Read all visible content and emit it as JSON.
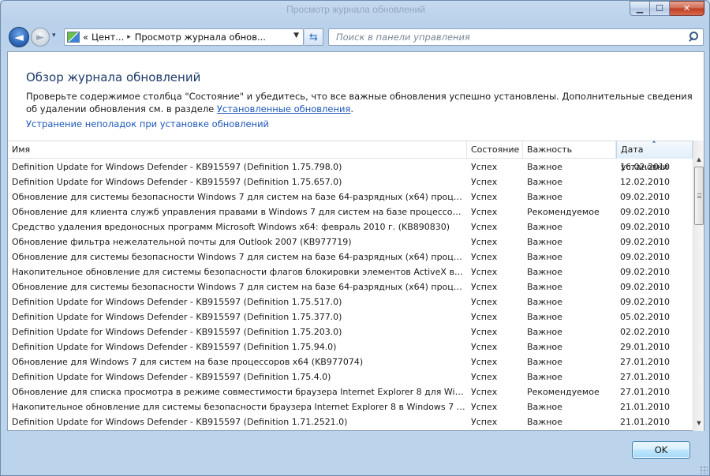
{
  "window": {
    "title": "Просмотр журнала обновлений",
    "caption": {
      "minimize": "▁",
      "maximize": "☐",
      "close": "✕"
    }
  },
  "nav": {
    "back_glyph": "◄",
    "forward_glyph": "►",
    "history_glyph": "▾",
    "address_prefix": "«",
    "address_segments": [
      "Цент...",
      "Просмотр журнала обнов..."
    ],
    "address_sep": "▸",
    "address_drop": "▼",
    "refresh_glyph": "⇆",
    "search_placeholder": "Поиск в панели управления"
  },
  "page": {
    "heading": "Обзор журнала обновлений",
    "description_text": "Проверьте содержимое столбца \"Состояние\" и убедитесь, что все важные обновления успешно установлены. Дополнительные сведения об удалении обновления см. в разделе ",
    "description_link": "Установленные обновления",
    "description_end": ".",
    "troubleshoot_link": "Устранение неполадок при установке обновлений"
  },
  "table": {
    "columns": [
      "Имя",
      "Состояние",
      "Важность",
      "Дата установки"
    ],
    "sort_glyph": "▴",
    "rows": [
      [
        "Definition Update for Windows Defender - KB915597 (Definition 1.75.798.0)",
        "Успех",
        "Важное",
        "16.02.2010"
      ],
      [
        "Definition Update for Windows Defender - KB915597 (Definition 1.75.657.0)",
        "Успех",
        "Важное",
        "12.02.2010"
      ],
      [
        "Обновление для системы безопасности Windows 7 для систем на базе 64-разрядных (x64) процессоро...",
        "Успех",
        "Важное",
        "09.02.2010"
      ],
      [
        "Обновление для клиента служб управления правами в Windows 7 для систем на базе процессоров x6...",
        "Успех",
        "Рекомендуемое",
        "09.02.2010"
      ],
      [
        "Средство удаления вредоносных программ Microsoft Windows x64: февраль 2010 г. (KB890830)",
        "Успех",
        "Важное",
        "09.02.2010"
      ],
      [
        "Обновление фильтра нежелательной почты для Outlook 2007 (KB977719)",
        "Успех",
        "Важное",
        "09.02.2010"
      ],
      [
        "Обновление для системы безопасности Windows 7 для систем на базе 64-разрядных (x64) процессоро...",
        "Успех",
        "Важное",
        "09.02.2010"
      ],
      [
        "Накопительное обновление для системы безопасности флагов блокировки элементов ActiveX в ОС ...",
        "Успех",
        "Важное",
        "09.02.2010"
      ],
      [
        "Обновление для системы безопасности Windows 7 для систем на базе 64-разрядных (x64) процессоро...",
        "Успех",
        "Важное",
        "09.02.2010"
      ],
      [
        "Definition Update for Windows Defender - KB915597 (Definition 1.75.517.0)",
        "Успех",
        "Важное",
        "09.02.2010"
      ],
      [
        "Definition Update for Windows Defender - KB915597 (Definition 1.75.377.0)",
        "Успех",
        "Важное",
        "05.02.2010"
      ],
      [
        "Definition Update for Windows Defender - KB915597 (Definition 1.75.203.0)",
        "Успех",
        "Важное",
        "02.02.2010"
      ],
      [
        "Definition Update for Windows Defender - KB915597 (Definition 1.75.94.0)",
        "Успех",
        "Важное",
        "29.01.2010"
      ],
      [
        "Обновление для Windows 7 для систем на базе процессоров x64 (KB977074)",
        "Успех",
        "Важное",
        "27.01.2010"
      ],
      [
        "Definition Update for Windows Defender - KB915597 (Definition 1.75.4.0)",
        "Успех",
        "Важное",
        "27.01.2010"
      ],
      [
        "Обновление для списка просмотра в режиме совместимости браузера Internet Explorer 8 для Window...",
        "Успех",
        "Рекомендуемое",
        "27.01.2010"
      ],
      [
        "Накопительное обновление для системы безопасности браузера Internet Explorer 8 в Windows 7 для к...",
        "Успех",
        "Важное",
        "21.01.2010"
      ],
      [
        "Definition Update for Windows Defender - KB915597 (Definition 1.71.2521.0)",
        "Успех",
        "Важное",
        "21.01.2010"
      ]
    ],
    "scroll": {
      "up": "▲",
      "down": "▼"
    }
  },
  "footer": {
    "ok_label": "OK"
  }
}
